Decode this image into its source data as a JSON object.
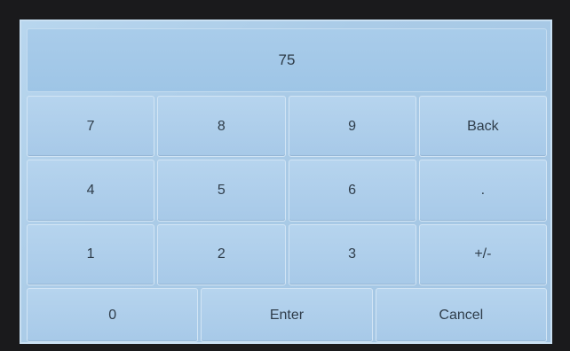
{
  "display": {
    "value": "75"
  },
  "keypad": {
    "rows": [
      [
        "7",
        "8",
        "9",
        "Back"
      ],
      [
        "4",
        "5",
        "6",
        "."
      ],
      [
        "1",
        "2",
        "3",
        "+/-"
      ]
    ],
    "bottom": [
      "0",
      "Enter",
      "Cancel"
    ]
  },
  "colors": {
    "bezel": "#1a1a1c",
    "screen": "#aacbe7",
    "key": "#b0cfeb",
    "text": "#2f3d4a"
  }
}
